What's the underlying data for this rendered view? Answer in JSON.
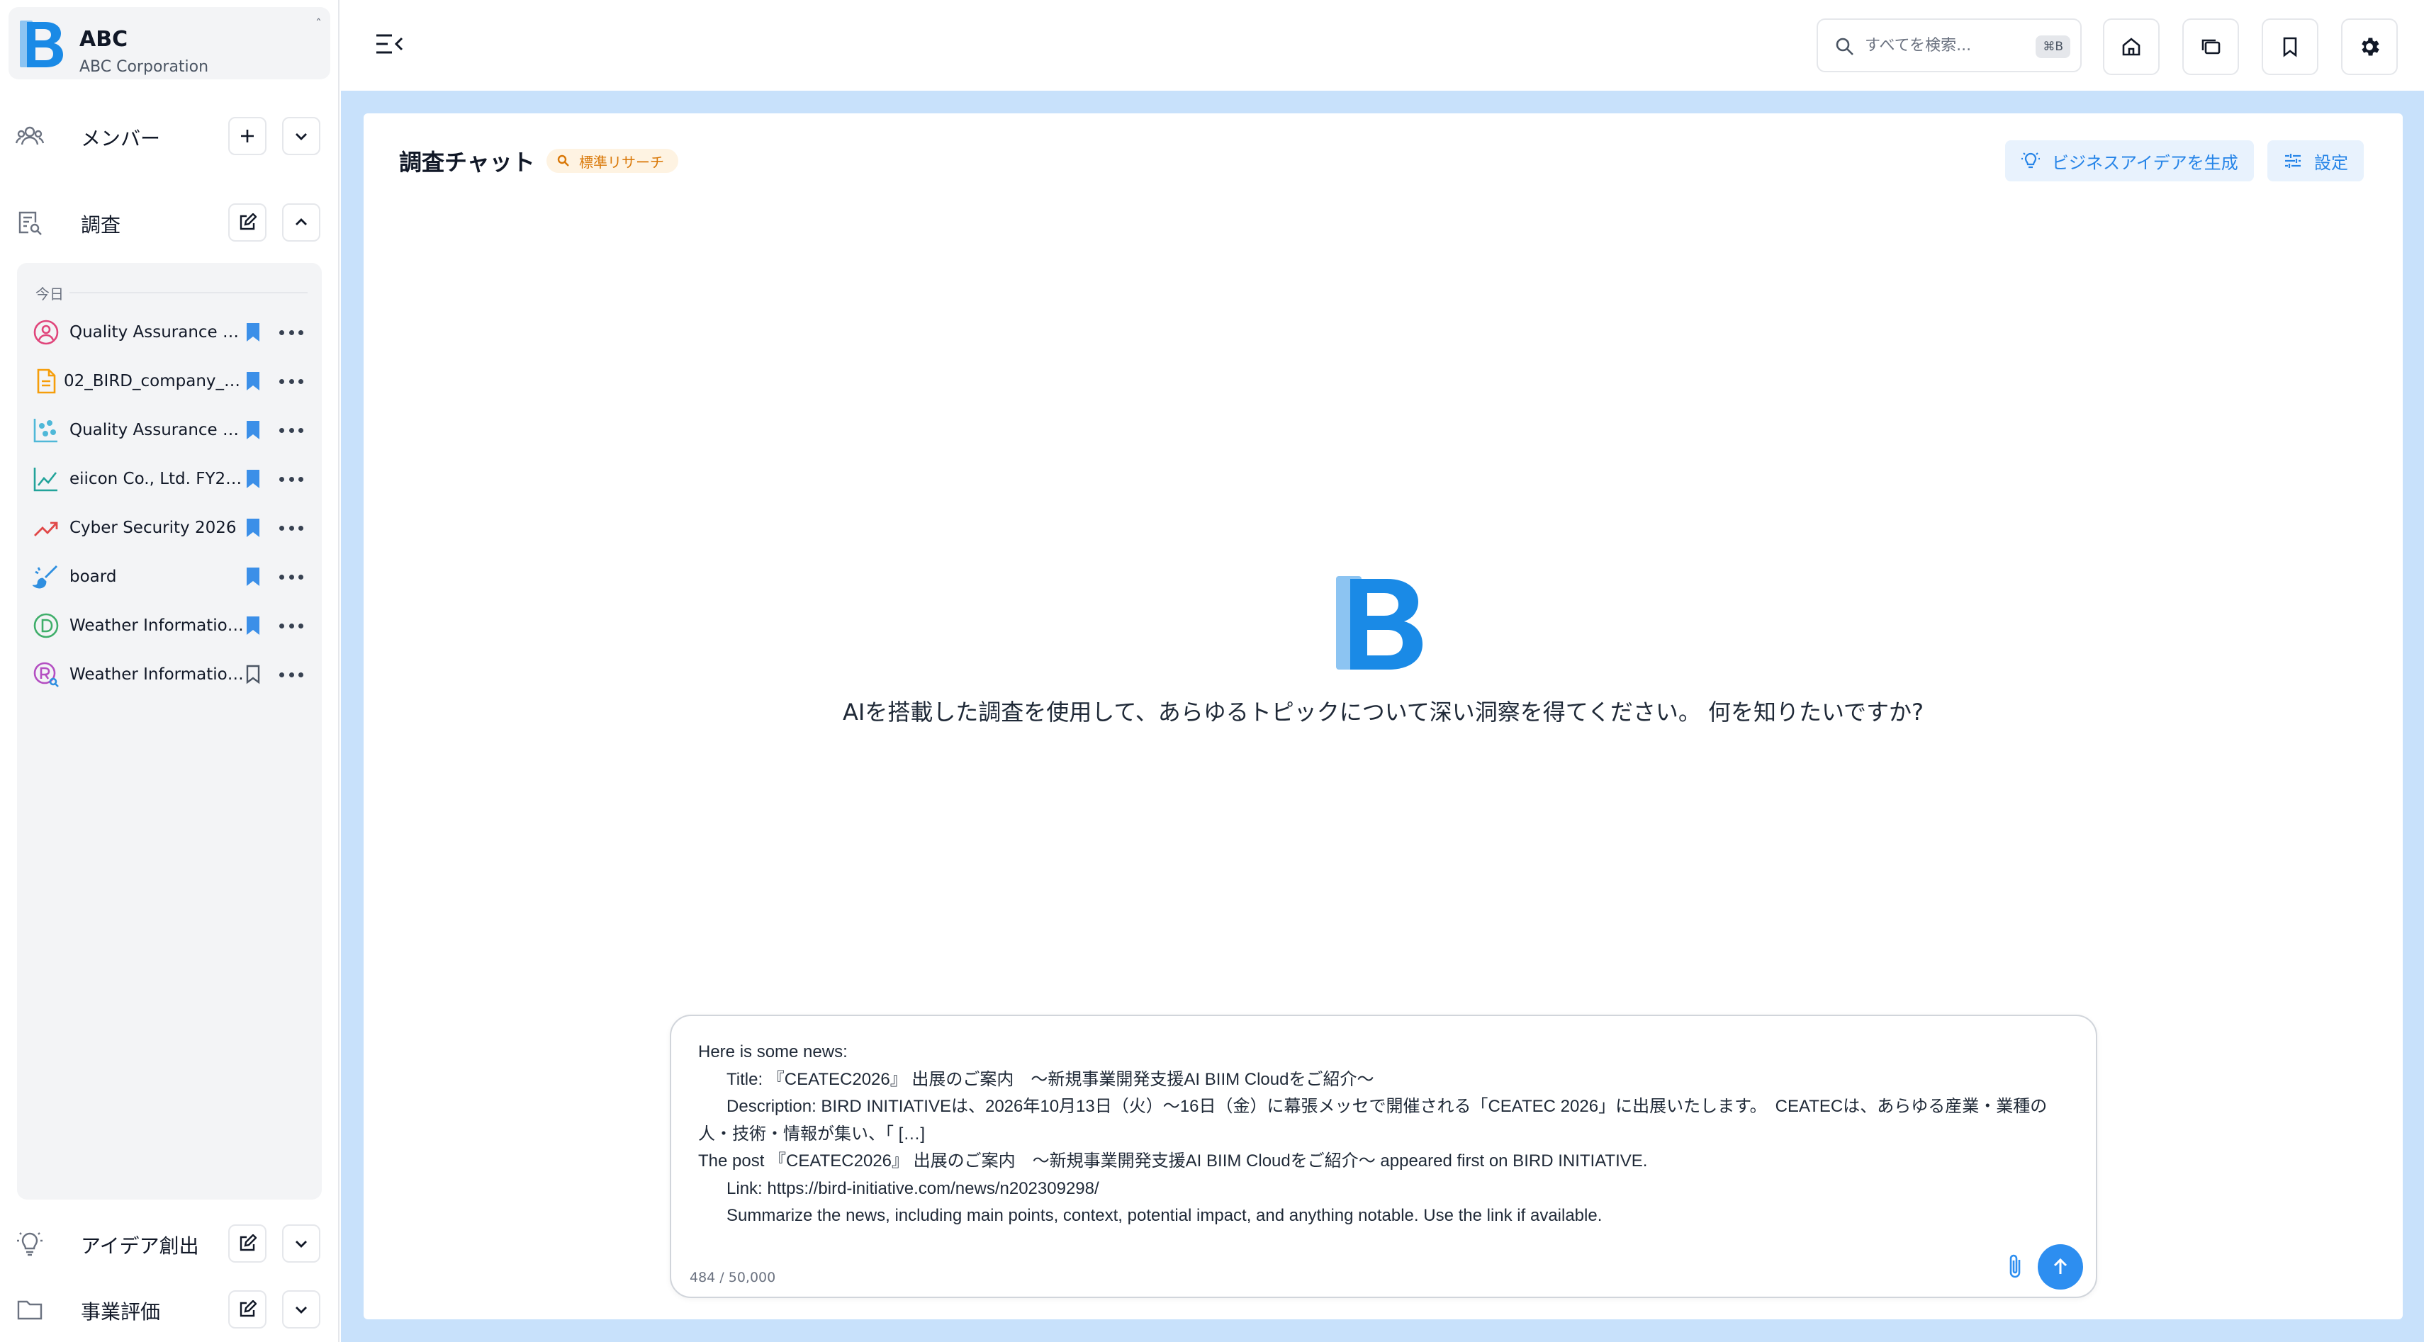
{
  "org": {
    "name": "ABC",
    "subtitle": "ABC Corporation",
    "toggle": "ˆ"
  },
  "sidebar": {
    "members_label": "メンバー",
    "research_label": "調査",
    "day_label": "今日",
    "items": [
      {
        "label": "Quality Assurance …",
        "icon": "user-circle-icon",
        "bookmarked": true
      },
      {
        "label": "02_BIRD_company_…",
        "icon": "document-icon",
        "bookmarked": true
      },
      {
        "label": "Quality Assurance …",
        "icon": "scatter-chart-icon",
        "bookmarked": true
      },
      {
        "label": "eiicon Co., Ltd. FY2…",
        "icon": "line-chart-icon",
        "bookmarked": true
      },
      {
        "label": "Cyber Security 2026",
        "icon": "trend-up-icon",
        "bookmarked": true
      },
      {
        "label": "board",
        "icon": "brush-icon",
        "bookmarked": true
      },
      {
        "label": "Weather Informatio…",
        "icon": "d-circle-icon",
        "bookmarked": true
      },
      {
        "label": "Weather Informatio…",
        "icon": "r-search-icon",
        "bookmarked": false
      }
    ],
    "ideas_label": "アイデア創出",
    "evaluation_label": "事業評価"
  },
  "topbar": {
    "search_placeholder": "すべてを検索...",
    "search_shortcut": "⌘B"
  },
  "chat": {
    "title": "調査チャット",
    "mode_pill": "標準リサーチ",
    "generate_ideas_label": "ビジネスアイデアを生成",
    "settings_label": "設定",
    "tagline": "AIを搭載した調査を使用して、あらゆるトピックについて深い洞察を得てください。 何を知りたいですか?",
    "composer_text": "Here is some news:\n      Title: 『CEATEC2026』 出展のご案内　～新規事業開発支援AI BIIM Cloudをご紹介～\n      Description: BIRD INITIATIVEは、2026年10月13日（火）～16日（金）に幕張メッセで開催される「CEATEC 2026」に出展いたします。　CEATECは、あらゆる産業・業種の人・技術・情報が集い、「 […]\nThe post 『CEATEC2026』 出展のご案内　～新規事業開発支援AI BIIM Cloudをご紹介～ appeared first on BIRD INITIATIVE.\n      Link: https://bird-initiative.com/news/n202309298/\n      Summarize the news, including main points, context, potential impact, and anything notable. Use the link if available.",
    "char_count": "484 / 50,000"
  },
  "colors": {
    "brand_blue": "#1a8ae6",
    "main_bg": "#c8e1fb",
    "accent_button": "#2d8ef0",
    "pill_orange": "#d97706",
    "bookmark_blue": "#3b8fe8"
  }
}
